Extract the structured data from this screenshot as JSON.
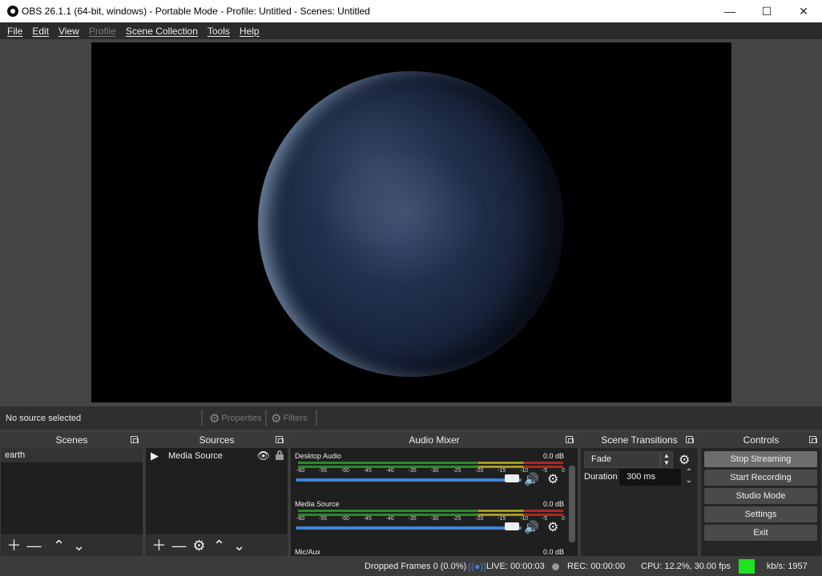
{
  "window": {
    "title": "OBS 26.1.1 (64-bit, windows) - Portable Mode - Profile: Untitled - Scenes: Untitled",
    "minimize": "—",
    "maximize": "☐",
    "close": "✕"
  },
  "menu": [
    "File",
    "Edit",
    "View",
    "Profile",
    "Scene Collection",
    "Tools",
    "Help"
  ],
  "source_toolbar": {
    "no_source": "No source selected",
    "properties": "Properties",
    "filters": "Filters"
  },
  "scenes": {
    "title": "Scenes",
    "items": [
      "earth"
    ]
  },
  "sources": {
    "title": "Sources",
    "items": [
      "Media Source"
    ]
  },
  "audio_mixer": {
    "title": "Audio Mixer",
    "ticks": [
      "-60",
      "-55",
      "-50",
      "-45",
      "-40",
      "-35",
      "-30",
      "-25",
      "-20",
      "-15",
      "-10",
      "-5",
      "0"
    ],
    "channels": [
      {
        "name": "Desktop Audio",
        "db": "0.0 dB"
      },
      {
        "name": "Media Source",
        "db": "0.0 dB"
      },
      {
        "name": "Mic/Aux",
        "db": "0.0 dB"
      }
    ]
  },
  "scene_transitions": {
    "title": "Scene Transitions",
    "transition": "Fade",
    "duration_label": "Duration",
    "duration_value": "300 ms"
  },
  "controls": {
    "title": "Controls",
    "stop_streaming": "Stop Streaming",
    "start_recording": "Start Recording",
    "studio_mode": "Studio Mode",
    "settings": "Settings",
    "exit": "Exit"
  },
  "status": {
    "dropped_frames": "Dropped Frames 0 (0.0%)",
    "live": "LIVE: 00:00:03",
    "rec": "REC: 00:00:00",
    "cpu": "CPU: 12.2%, 30.00 fps",
    "kbps": "kb/s: 1957"
  },
  "colors": {
    "status_ok": "#22e022",
    "slider": "#3e84d8"
  }
}
